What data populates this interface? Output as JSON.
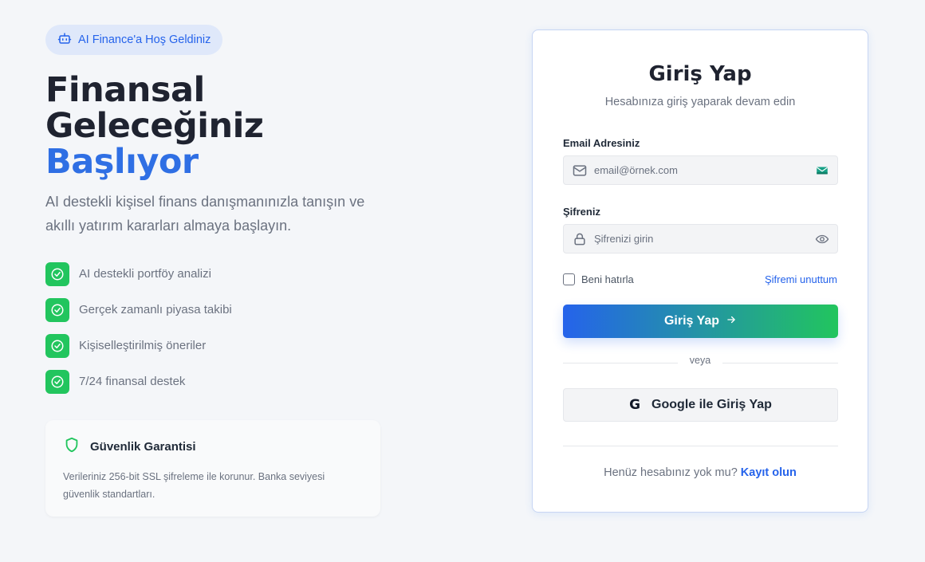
{
  "welcome": {
    "label": "AI Finance'a Hoş Geldiniz",
    "icon": "robot-icon"
  },
  "hero": {
    "line1": "Finansal",
    "line2": "Geleceğiniz",
    "line3": "Başlıyor",
    "accent_color": "#2f6fe4",
    "lead": "AI destekli kişisel finans danışmanınızla tanışın ve akıllı yatırım kararları almaya başlayın."
  },
  "features": [
    {
      "label": "AI destekli portföy analizi",
      "icon": "check-circle-icon"
    },
    {
      "label": "Gerçek zamanlı piyasa takibi",
      "icon": "check-circle-icon"
    },
    {
      "label": "Kişiselleştirilmiş öneriler",
      "icon": "check-circle-icon"
    },
    {
      "label": "7/24 finansal destek",
      "icon": "check-circle-icon"
    }
  ],
  "security": {
    "title": "Güvenlik Garantisi",
    "text": "Verileriniz 256-bit SSL şifreleme ile korunur. Banka seviyesi güvenlik standartları.",
    "icon": "shield-icon"
  },
  "login": {
    "title": "Giriş Yap",
    "subtitle": "Hesabınıza giriş yaparak devam edin",
    "email_label": "Email Adresiniz",
    "email_placeholder": "email@örnek.com",
    "email_value": "",
    "password_label": "Şifreniz",
    "password_placeholder": "Şifrenizi girin",
    "password_value": "",
    "remember_label": "Beni hatırla",
    "remember_checked": false,
    "forgot_label": "Şifremi unuttum",
    "submit_label": "Giriş Yap",
    "divider_label": "veya",
    "google_label": "Google ile Giriş Yap",
    "signup_prompt": "Henüz hesabınız yok mu?",
    "signup_link": "Kayıt olun",
    "gradient_start": "#2563eb",
    "gradient_end": "#22c55e"
  }
}
